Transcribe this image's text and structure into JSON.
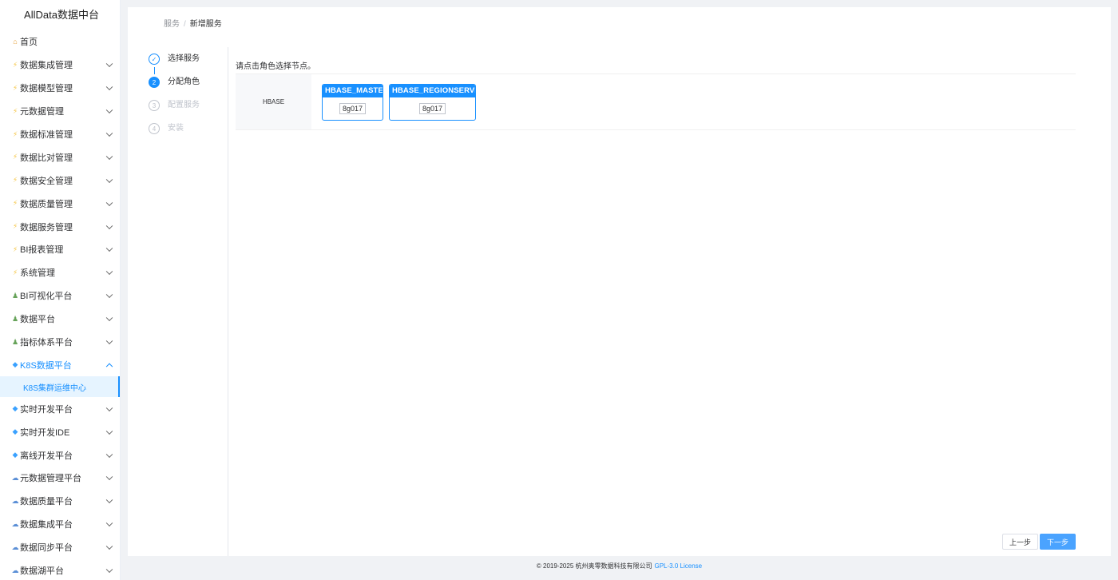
{
  "app": {
    "title": "AllData数据中台"
  },
  "sidebar": {
    "items": [
      {
        "label": "首页",
        "icon": "home-icon",
        "has_children": false
      },
      {
        "label": "数据集成管理",
        "icon": "bolt-icon",
        "has_children": true
      },
      {
        "label": "数据模型管理",
        "icon": "bolt-icon",
        "has_children": true
      },
      {
        "label": "元数据管理",
        "icon": "bolt-icon",
        "has_children": true
      },
      {
        "label": "数据标准管理",
        "icon": "bolt-icon",
        "has_children": true
      },
      {
        "label": "数据比对管理",
        "icon": "bolt-icon",
        "has_children": true
      },
      {
        "label": "数据安全管理",
        "icon": "bolt-icon",
        "has_children": true
      },
      {
        "label": "数据质量管理",
        "icon": "bolt-icon",
        "has_children": true
      },
      {
        "label": "数据服务管理",
        "icon": "bolt-icon",
        "has_children": true
      },
      {
        "label": "BI报表管理",
        "icon": "bolt-icon",
        "has_children": true
      },
      {
        "label": "系统管理",
        "icon": "bolt-icon",
        "has_children": true
      },
      {
        "label": "BI可视化平台",
        "icon": "user-icon",
        "has_children": true
      },
      {
        "label": "数据平台",
        "icon": "user-icon",
        "has_children": true
      },
      {
        "label": "指标体系平台",
        "icon": "user-icon",
        "has_children": true
      },
      {
        "label": "K8S数据平台",
        "icon": "gem-icon",
        "has_children": true,
        "open": true,
        "children": [
          {
            "label": "K8S集群运维中心",
            "active": true
          }
        ]
      },
      {
        "label": "实时开发平台",
        "icon": "gem-icon",
        "has_children": true
      },
      {
        "label": "实时开发IDE",
        "icon": "gem-icon",
        "has_children": true
      },
      {
        "label": "离线开发平台",
        "icon": "gem-icon",
        "has_children": true
      },
      {
        "label": "元数据管理平台",
        "icon": "cloud-icon",
        "has_children": true
      },
      {
        "label": "数据质量平台",
        "icon": "cloud-icon",
        "has_children": true
      },
      {
        "label": "数据集成平台",
        "icon": "cloud-icon",
        "has_children": true
      },
      {
        "label": "数据同步平台",
        "icon": "cloud-icon",
        "has_children": true
      },
      {
        "label": "数据湖平台",
        "icon": "cloud-icon",
        "has_children": true
      }
    ]
  },
  "breadcrumb": {
    "parent": "服务",
    "separator": "/",
    "current": "新增服务"
  },
  "steps": [
    {
      "number": "",
      "label": "选择服务",
      "status": "done"
    },
    {
      "number": "2",
      "label": "分配角色",
      "status": "active"
    },
    {
      "number": "3",
      "label": "配置服务",
      "status": "pending"
    },
    {
      "number": "4",
      "label": "安装",
      "status": "pending"
    }
  ],
  "assign": {
    "hint": "请点击角色选择节点。",
    "service": "HBASE",
    "roles": [
      {
        "name": "HBASE_MASTER",
        "host": "8g017"
      },
      {
        "name": "HBASE_REGIONSERVER",
        "host": "8g017"
      }
    ]
  },
  "buttons": {
    "prev": "上一步",
    "next": "下一步"
  },
  "footer": {
    "copyright": "© 2019-2025 杭州奥零数据科技有限公司",
    "license": "GPL-3.0 License"
  },
  "colors": {
    "primary": "#1890ff",
    "next_button": "#4aa3ff"
  }
}
